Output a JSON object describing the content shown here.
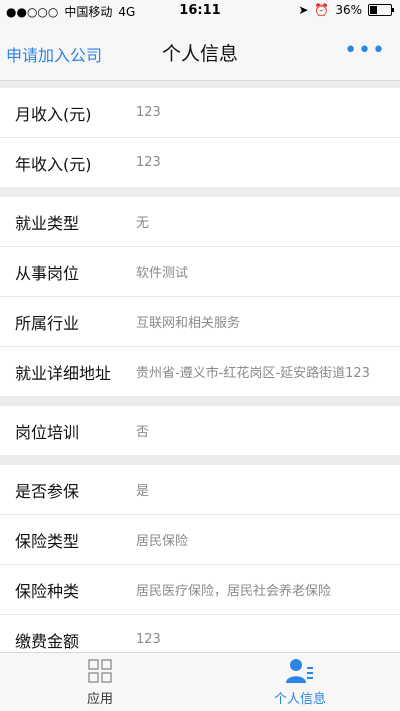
{
  "status_bar": {
    "signal": "●●○○○",
    "carrier": "中国移动",
    "network": "4G",
    "time": "16:11",
    "battery_percent": "36%",
    "battery_level": 0.36
  },
  "nav": {
    "left_link": "申请加入公司",
    "title": "个人信息",
    "more": "•••"
  },
  "groups": [
    [
      {
        "label": "月收入(元)",
        "value": "123"
      },
      {
        "label": "年收入(元)",
        "value": "123"
      }
    ],
    [
      {
        "label": "就业类型",
        "value": "无"
      },
      {
        "label": "从事岗位",
        "value": "软件测试"
      },
      {
        "label": "所属行业",
        "value": "互联网和相关服务"
      },
      {
        "label": "就业详细地址",
        "value": "贵州省-遵义市-红花岗区-延安路街道123"
      }
    ],
    [
      {
        "label": "岗位培训",
        "value": "否"
      }
    ],
    [
      {
        "label": "是否参保",
        "value": "是"
      },
      {
        "label": "保险类型",
        "value": "居民保险"
      },
      {
        "label": "保险种类",
        "value": "居民医疗保险，居民社会养老保险"
      },
      {
        "label": "缴费金额",
        "value": "123"
      }
    ]
  ],
  "tabbar": {
    "apps_label": "应用",
    "profile_label": "个人信息"
  },
  "colors": {
    "accent": "#2b85e4"
  }
}
